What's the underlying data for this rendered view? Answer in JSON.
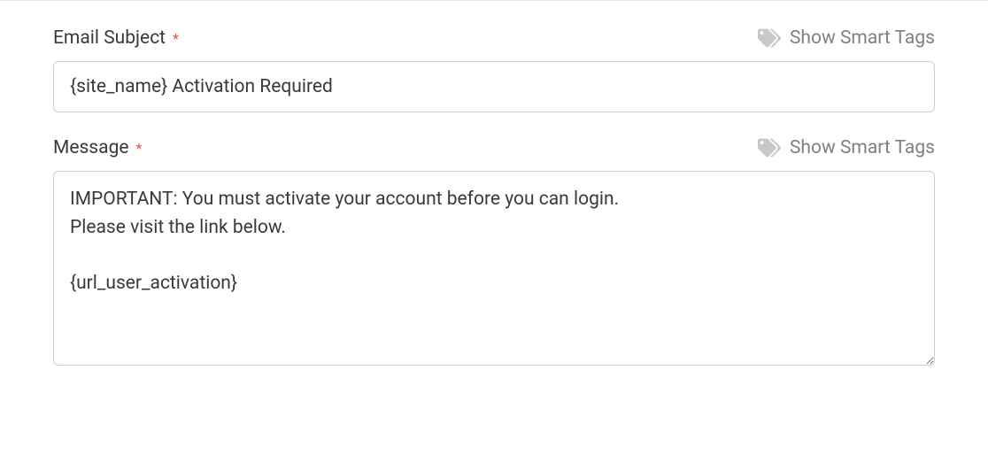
{
  "email_subject": {
    "label": "Email Subject",
    "required_mark": "*",
    "smart_tags_label": "Show Smart Tags",
    "value": "{site_name} Activation Required"
  },
  "message": {
    "label": "Message",
    "required_mark": "*",
    "smart_tags_label": "Show Smart Tags",
    "value": "IMPORTANT: You must activate your account before you can login.\nPlease visit the link below.\n\n{url_user_activation}"
  }
}
